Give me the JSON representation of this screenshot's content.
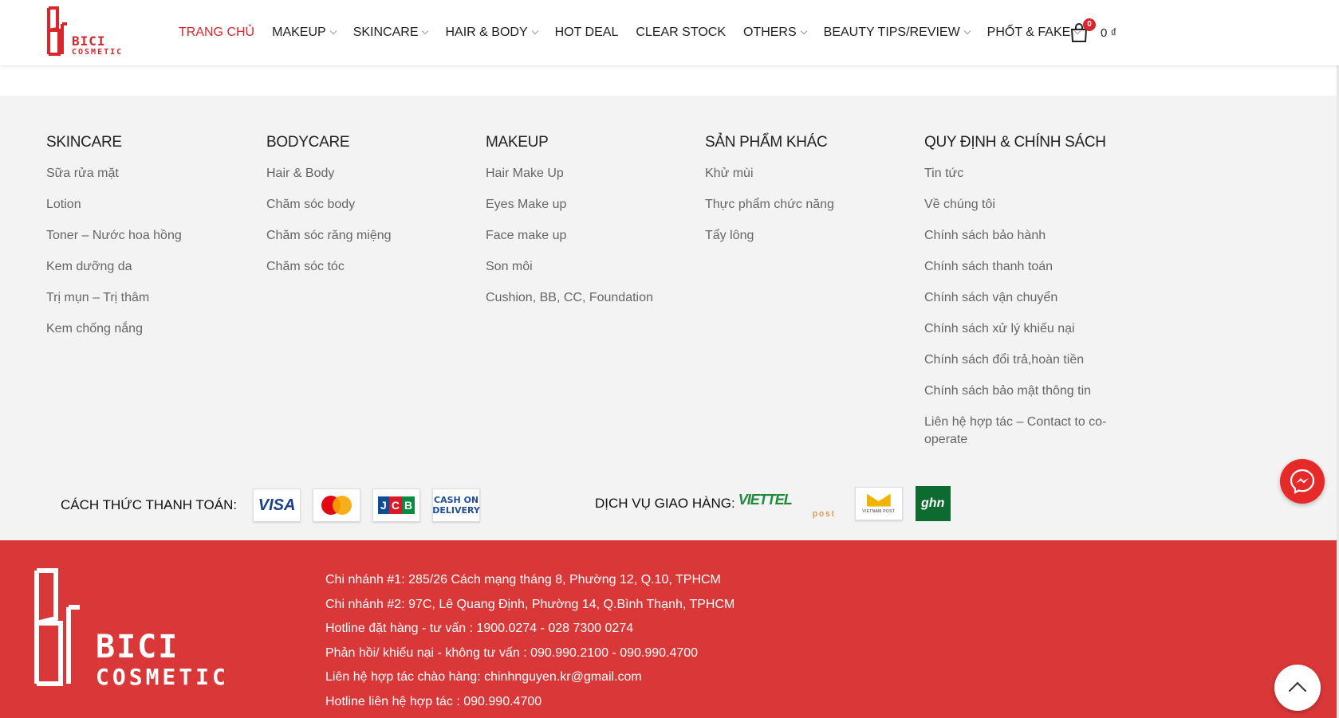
{
  "brand": {
    "line1": "BICI",
    "line2": "COSMETIC",
    "color": "#d9262c"
  },
  "nav": [
    {
      "label": "TRANG CHỦ",
      "active": true,
      "dropdown": false
    },
    {
      "label": "MAKEUP",
      "active": false,
      "dropdown": true
    },
    {
      "label": "SKINCARE",
      "active": false,
      "dropdown": true
    },
    {
      "label": "HAIR & BODY",
      "active": false,
      "dropdown": true
    },
    {
      "label": "HOT DEAL",
      "active": false,
      "dropdown": false
    },
    {
      "label": "CLEAR STOCK",
      "active": false,
      "dropdown": false
    },
    {
      "label": "OTHERS",
      "active": false,
      "dropdown": true
    },
    {
      "label": "BEAUTY TIPS/REVIEW",
      "active": false,
      "dropdown": true
    },
    {
      "label": "PHỐT & FAKE",
      "active": false,
      "dropdown": true
    }
  ],
  "cart": {
    "count": "0",
    "total": "0 ₫",
    "icon": "shopping-bag-icon"
  },
  "footer_columns": [
    {
      "title": "SKINCARE",
      "items": [
        "Sữa rửa mặt",
        "Lotion",
        "Toner – Nước hoa hồng",
        "Kem dưỡng da",
        "Trị mụn – Trị thâm",
        "Kem chống nắng"
      ]
    },
    {
      "title": "BODYCARE",
      "items": [
        "Hair & Body",
        "Chăm sóc body",
        "Chăm sóc răng miệng",
        "Chăm sóc tóc"
      ]
    },
    {
      "title": "MAKEUP",
      "items": [
        "Hair Make Up",
        "Eyes Make up",
        "Face make up",
        "Son môi",
        "Cushion, BB, CC, Foundation"
      ]
    },
    {
      "title": "SẢN PHẨM KHÁC",
      "items": [
        "Khử mùi",
        "Thực phẩm chức năng",
        "Tẩy lông"
      ]
    },
    {
      "title": "QUY ĐỊNH & CHÍNH SÁCH",
      "items": [
        "Tin tức",
        "Về chúng tôi",
        "Chính sách bảo hành",
        "Chính sách thanh toán",
        "Chính sách vận chuyển",
        "Chính sách xử lý khiếu nại",
        "Chính sách đổi trả,hoàn tiền",
        "Chính sách bảo mật thông tin",
        "Liên hệ hợp tác – Contact to co-operate"
      ]
    }
  ],
  "payment": {
    "label": "CÁCH THỨC THANH TOÁN:",
    "visa": "VISA",
    "mastercard": "MasterCard",
    "jcb": [
      "J",
      "C",
      "B"
    ],
    "cod": [
      "CASH ON",
      "DELIVERY"
    ]
  },
  "shipping": {
    "label": "DỊCH VỤ GIAO HÀNG:",
    "viettel": "VIETTEL",
    "viettel_sub": "post",
    "vnpost": "VIETNAM POST",
    "ghn": "ghn"
  },
  "contact": [
    "Chi nhánh #1: 285/26 Cách mạng tháng 8, Phường 12, Q.10, TPHCM",
    "Chi nhánh #2: 97C, Lê Quang Định, Phường 14, Q.Bình Thạnh, TPHCM",
    "Hotline đặt hàng - tư vấn : 1900.0274 - 028 7300 0274",
    "Phản hồi/ khiếu nại - không tư vấn : 090.990.2100 - 090.990.4700",
    "Liên hệ hợp tác chào hàng: chinhnguyen.kr@gmail.com",
    "Hotline liên hệ hợp tác : 090.990.4700"
  ],
  "colors": {
    "accent": "#d9262c",
    "footer_red": "#da3838",
    "footer_bg": "#f3f3f3"
  }
}
